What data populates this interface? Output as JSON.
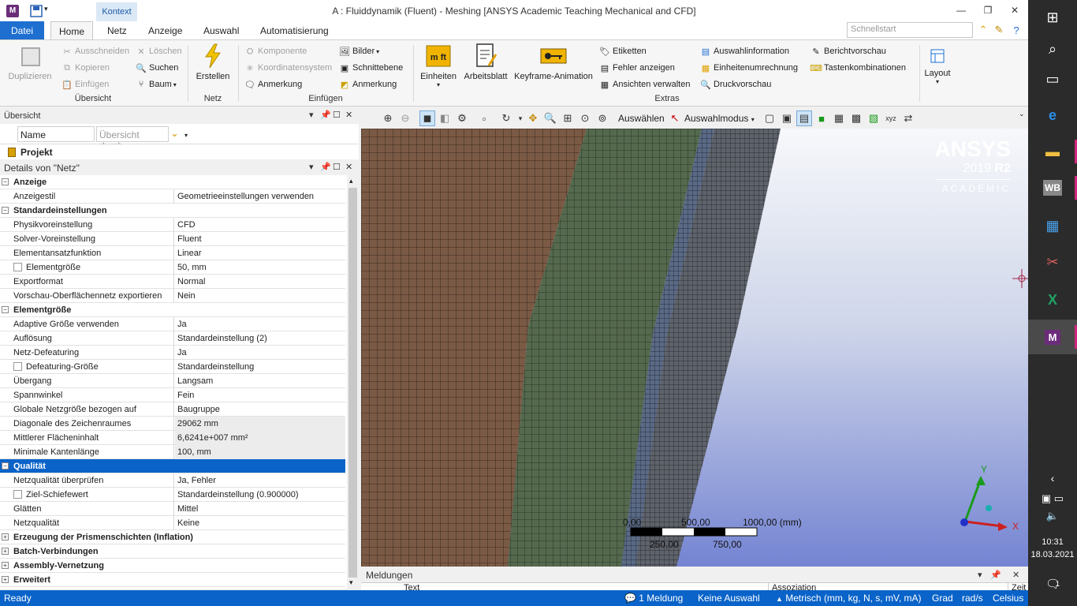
{
  "titlebar": {
    "app_icon": "M",
    "context_tab": "Kontext",
    "title": "A : Fluiddynamik (Fluent) - Meshing [ANSYS Academic Teaching Mechanical and CFD]"
  },
  "ribbon_tabs": [
    "Datei",
    "Home",
    "Netz",
    "Anzeige",
    "Auswahl",
    "Automatisierung"
  ],
  "active_tab": "Home",
  "quickstart_placeholder": "Schnellstart",
  "ribbon": {
    "uebersicht": {
      "label": "Übersicht",
      "duplizieren": "Duplizieren",
      "ausschneiden": "Ausschneiden",
      "kopieren": "Kopieren",
      "einfuegen": "Einfügen",
      "loeschen": "Löschen",
      "suchen": "Suchen",
      "baum": "Baum"
    },
    "netz": {
      "label": "Netz",
      "erstellen": "Erstellen"
    },
    "einfuegen": {
      "label": "Einfügen",
      "komponente": "Komponente",
      "koordinatensystem": "Koordinatensystem",
      "anmerkung": "Anmerkung",
      "bilder": "Bilder",
      "schnittebene": "Schnittebene",
      "anmerkung2": "Anmerkung"
    },
    "extras": {
      "label": "Extras",
      "einheiten": "Einheiten",
      "arbeitsblatt": "Arbeitsblatt",
      "keyframe": "Keyframe-Animation",
      "etiketten": "Etiketten",
      "fehler": "Fehler anzeigen",
      "ansichten": "Ansichten verwalten",
      "auswahlinfo": "Auswahlinformation",
      "einheitenumrechnung": "Einheitenumrechnung",
      "druckvorschau": "Druckvorschau",
      "berichtvorschau": "Berichtvorschau",
      "tastenkombinationen": "Tastenkombinationen"
    },
    "layout": {
      "label": "Layout"
    }
  },
  "outline": {
    "title": "Übersicht",
    "filter_name": "Name",
    "filter_placeholder": "Übersicht durch",
    "project": "Projekt"
  },
  "details": {
    "title": "Details von \"Netz\"",
    "rows": [
      {
        "type": "cat",
        "label": "Anzeige",
        "toggle": "−"
      },
      {
        "type": "prop",
        "label": "Anzeigestil",
        "value": "Geometrieeinstellungen verwenden"
      },
      {
        "type": "cat",
        "label": "Standardeinstellungen",
        "toggle": "−"
      },
      {
        "type": "prop",
        "label": "Physikvoreinstellung",
        "value": "CFD"
      },
      {
        "type": "prop",
        "label": "Solver-Voreinstellung",
        "value": "Fluent"
      },
      {
        "type": "prop",
        "label": "Elementansatzfunktion",
        "value": "Linear"
      },
      {
        "type": "prop",
        "label": "Elementgröße",
        "value": "50, mm",
        "checkbox": true
      },
      {
        "type": "prop",
        "label": "Exportformat",
        "value": "Normal"
      },
      {
        "type": "prop",
        "label": "Vorschau-Oberflächennetz exportieren",
        "value": "Nein"
      },
      {
        "type": "cat",
        "label": "Elementgröße",
        "toggle": "−"
      },
      {
        "type": "prop",
        "label": "Adaptive Größe verwenden",
        "value": "Ja"
      },
      {
        "type": "prop",
        "label": "Auflösung",
        "value": "Standardeinstellung (2)"
      },
      {
        "type": "prop",
        "label": "Netz-Defeaturing",
        "value": "Ja"
      },
      {
        "type": "prop",
        "label": "Defeaturing-Größe",
        "value": "Standardeinstellung",
        "checkbox": true
      },
      {
        "type": "prop",
        "label": "Übergang",
        "value": "Langsam"
      },
      {
        "type": "prop",
        "label": "Spannwinkel",
        "value": "Fein"
      },
      {
        "type": "prop",
        "label": "Globale Netzgröße bezogen auf",
        "value": "Baugruppe"
      },
      {
        "type": "prop",
        "label": "Diagonale des Zeichenraumes",
        "value": "29062 mm",
        "readonly": true
      },
      {
        "type": "prop",
        "label": "Mittlerer Flächeninhalt",
        "value": "6,6241e+007 mm²",
        "readonly": true
      },
      {
        "type": "prop",
        "label": "Minimale Kantenlänge",
        "value": "100, mm",
        "readonly": true
      },
      {
        "type": "cat",
        "label": "Qualität",
        "toggle": "−",
        "selected": true
      },
      {
        "type": "prop",
        "label": "Netzqualität überprüfen",
        "value": "Ja, Fehler"
      },
      {
        "type": "prop",
        "label": "Ziel-Schiefewert",
        "value": "Standardeinstellung (0.900000)",
        "checkbox": true
      },
      {
        "type": "prop",
        "label": "Glätten",
        "value": "Mittel"
      },
      {
        "type": "prop",
        "label": "Netzqualität",
        "value": "Keine"
      },
      {
        "type": "cat",
        "label": "Erzeugung der Prismenschichten (Inflation)",
        "toggle": "+"
      },
      {
        "type": "cat",
        "label": "Batch-Verbindungen",
        "toggle": "+"
      },
      {
        "type": "cat",
        "label": "Assembly-Vernetzung",
        "toggle": "+"
      },
      {
        "type": "cat",
        "label": "Erweitert",
        "toggle": "+"
      }
    ]
  },
  "gfx_toolbar": {
    "auswaehlen": "Auswählen",
    "auswahlmodus": "Auswahlmodus"
  },
  "viewport": {
    "brand_name": "ANSYS",
    "brand_version": "2019",
    "brand_release": "R2",
    "brand_edition": "ACADEMIC",
    "scale": {
      "t0": "0,00",
      "t500": "500,00",
      "t1000": "1000,00 (mm)",
      "t250": "250,00",
      "t750": "750,00"
    },
    "axis": {
      "x": "X",
      "y": "Y"
    }
  },
  "messages": {
    "title": "Meldungen",
    "col_text": "Text",
    "col_assoc": "Assoziation",
    "col_time": "Zeit"
  },
  "statusbar": {
    "ready": "Ready",
    "messages": "1 Meldung",
    "selection": "Keine Auswahl",
    "units": "Metrisch (mm, kg, N, s, mV, mA)",
    "angle": "Grad",
    "rate": "rad/s",
    "temp": "Celsius"
  },
  "taskbar": {
    "time": "10:31",
    "date": "18.03.2021",
    "notif_count": "1"
  },
  "colors": {
    "accent": "#0a63c9",
    "mesh_brown": "#7a5a45",
    "mesh_green": "#55694e",
    "mesh_gray": "#5e626a"
  }
}
